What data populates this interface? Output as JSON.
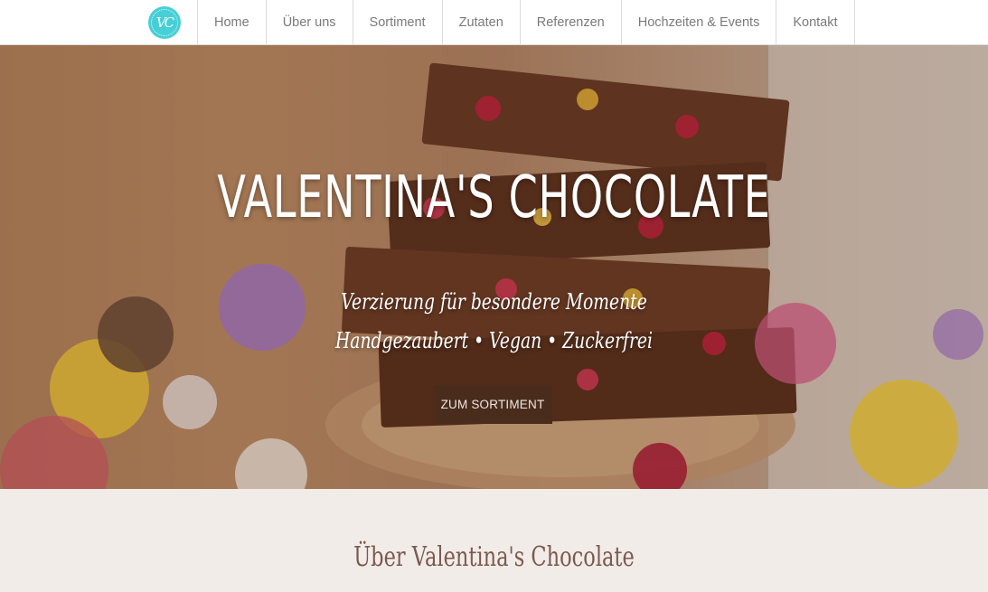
{
  "nav": {
    "logo_text": "VC",
    "items": [
      {
        "label": "Home"
      },
      {
        "label": "Über uns"
      },
      {
        "label": "Sortiment"
      },
      {
        "label": "Zutaten"
      },
      {
        "label": "Referenzen"
      },
      {
        "label": "Hochzeiten & Events"
      },
      {
        "label": "Kontakt"
      }
    ]
  },
  "hero": {
    "title": "VALENTINA'S CHOCOLATE",
    "tagline_1": "Verzierung für besondere Momente",
    "tagline_2": "Handgezaubert • Vegan • Zuckerfrei",
    "cta_label": "ZUM SORTIMENT"
  },
  "about": {
    "heading": "Über Valentina's Chocolate"
  },
  "colors": {
    "logo": "#46cfd6",
    "cta_bg": "#4a2c1d",
    "about_bg": "#f2ece8",
    "about_heading": "#7a5a4f"
  }
}
